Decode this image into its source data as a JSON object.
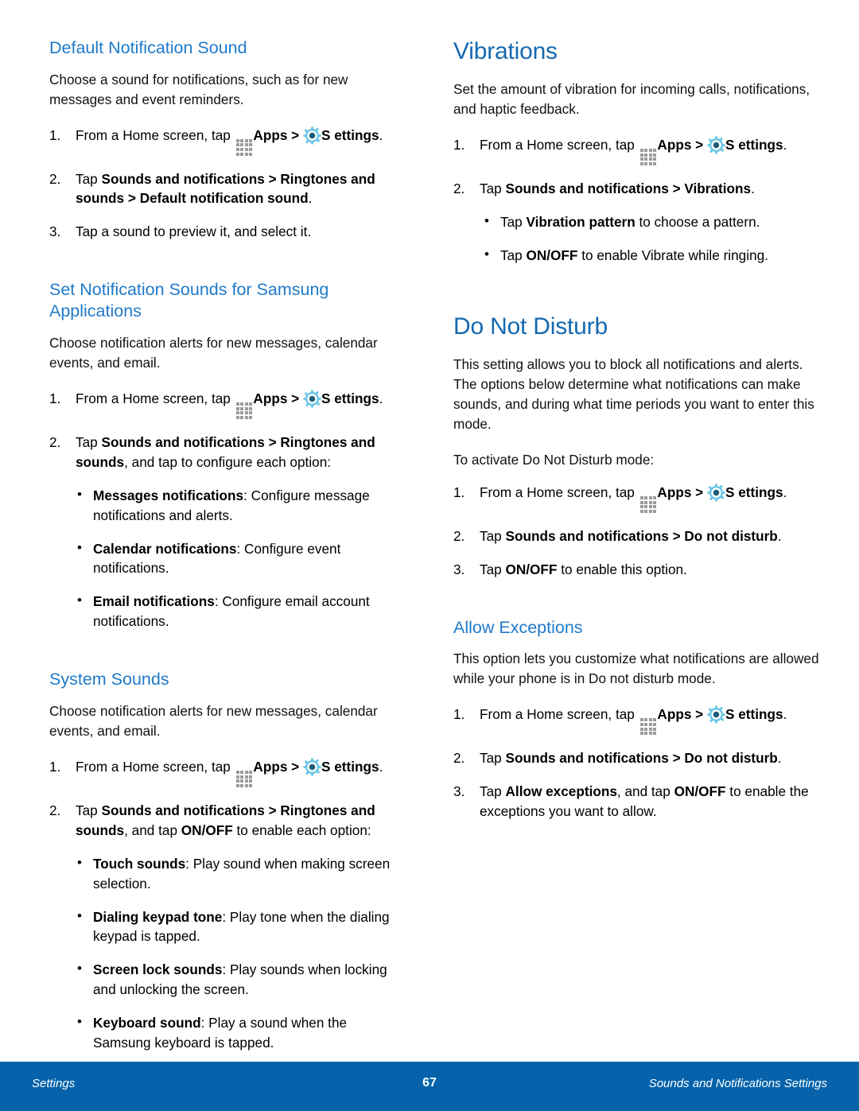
{
  "document": {
    "type": "user-manual-page",
    "page_number": "67"
  },
  "colors": {
    "h1_blue": "#1569b0",
    "h2_blue": "#1f7ac9",
    "footer_blue": "#0663ab",
    "apps_icon_gray": "#9b9b9b",
    "gear_icon_blue": "#5ec3e4"
  },
  "icons": {
    "apps": "apps-grid-icon",
    "settings": "settings-gear-icon"
  },
  "left_column": {
    "section1": {
      "heading": "Default Notification Sound",
      "intro": "Choose a sound for notifications, such as for new messages and event reminders.",
      "steps": [
        {
          "num": "1.",
          "pre": "From a Home screen, tap ",
          "apps_label": "Apps",
          "mid": " > ",
          "settings_label": "S ettings",
          "post": "."
        },
        {
          "num": "2.",
          "pre": "Tap ",
          "bold1": "Sounds and notifications > Ringtones and sounds > Default notification sound",
          "post": "."
        },
        {
          "num": "3.",
          "pre": "Tap a sound to preview it, and select it.",
          "post": ""
        }
      ]
    },
    "section2": {
      "heading": "Set Notification Sounds for Samsung Applications",
      "intro": "Choose notification alerts for new messages, calendar events, and email.",
      "steps": [
        {
          "num": "1.",
          "pre": "From a Home screen, tap ",
          "apps_label": "Apps",
          "mid": " > ",
          "settings_label": "S ettings",
          "post": "."
        },
        {
          "num": "2.",
          "pre": "Tap ",
          "bold1": "Sounds and notifications > Ringtones and sounds",
          "post": ", and tap to configure each option:"
        }
      ],
      "bullets": [
        {
          "bold": "Messages notifications",
          "rest": ": Configure message notifications and alerts."
        },
        {
          "bold": "Calendar notifications",
          "rest": ": Configure event notifications."
        },
        {
          "bold": "Email notifications",
          "rest": ": Configure email account notifications."
        }
      ]
    },
    "section3": {
      "heading": "System Sounds",
      "intro": "Choose notification alerts for new messages, calendar events, and email.",
      "steps": [
        {
          "num": "1.",
          "pre": "From a Home screen, tap ",
          "apps_label": "Apps",
          "mid": " > ",
          "settings_label": "S ettings",
          "post": "."
        },
        {
          "num": "2.",
          "pre": "Tap ",
          "bold1": "Sounds and notifications > Ringtones and sounds",
          "mid": ", and tap ",
          "bold2": "ON/OFF",
          "post": " to enable each option:"
        }
      ],
      "bullets": [
        {
          "bold": "Touch sounds",
          "rest": ": Play sound when making screen selection."
        },
        {
          "bold": "Dialing keypad tone",
          "rest": ": Play tone when the dialing keypad is tapped."
        },
        {
          "bold": "Screen lock sounds",
          "rest": ": Play sounds when locking and unlocking the screen."
        },
        {
          "bold": "Keyboard sound",
          "rest": ": Play a sound when the Samsung keyboard is tapped."
        }
      ]
    }
  },
  "right_column": {
    "section1": {
      "heading": "Vibrations",
      "intro": "Set the amount of vibration for incoming calls, notifications, and haptic feedback.",
      "steps": [
        {
          "num": "1.",
          "pre": "From a Home screen, tap ",
          "apps_label": "Apps",
          "mid": " > ",
          "settings_label": "S ettings",
          "post": "."
        },
        {
          "num": "2.",
          "pre": "Tap ",
          "bold1": "Sounds and notifications > Vibrations",
          "post": "."
        }
      ],
      "bullets": [
        {
          "pre": "Tap ",
          "bold": "Vibration pattern",
          "rest": " to choose a pattern."
        },
        {
          "pre": "Tap ",
          "bold": "ON/OFF",
          "rest": " to enable Vibrate while ringing."
        }
      ]
    },
    "section2": {
      "heading": "Do Not Disturb",
      "intro": "This setting allows you to block all notifications and alerts. The options below determine what notifications can make sounds, and during what time periods you want to enter this mode.",
      "activate_line": "To activate Do Not Disturb mode:",
      "steps": [
        {
          "num": "1.",
          "pre": "From a Home screen, tap ",
          "apps_label": "Apps",
          "mid": " > ",
          "settings_label": "S ettings",
          "post": "."
        },
        {
          "num": "2.",
          "pre": "Tap ",
          "bold1": "Sounds and notifications > Do not disturb",
          "post": "."
        },
        {
          "num": "3.",
          "pre": "Tap ",
          "bold1": "ON/OFF",
          "post": " to enable this option."
        }
      ]
    },
    "section3": {
      "heading": "Allow Exceptions",
      "intro": "This option lets you customize what notifications are allowed while your phone is in Do not disturb mode.",
      "steps": [
        {
          "num": "1.",
          "pre": "From a Home screen, tap ",
          "apps_label": "Apps",
          "mid": " > ",
          "settings_label": "S ettings",
          "post": "."
        },
        {
          "num": "2.",
          "pre": "Tap ",
          "bold1": "Sounds and notifications > Do not disturb",
          "post": "."
        },
        {
          "num": "3.",
          "pre": "Tap ",
          "bold1": "Allow exceptions",
          "mid": ", and tap ",
          "bold2": "ON/OFF",
          "post": " to enable the exceptions you want to allow."
        }
      ]
    }
  },
  "footer": {
    "left": "Settings",
    "center": "67",
    "right": "Sounds and Notifications Settings"
  }
}
